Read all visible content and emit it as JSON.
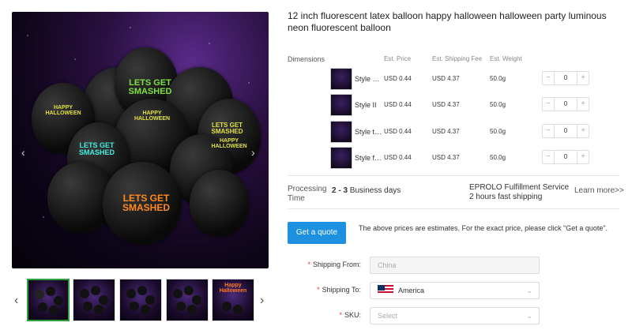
{
  "product": {
    "title": "12 inch fluorescent latex balloon happy halloween halloween party luminous neon fluorescent balloon",
    "main_image_alt": "",
    "balloon_texts": {
      "lets_get_smashed": "LETS GET SMASHED",
      "happy_halloween": "HAPPY HALLOWEEN"
    },
    "thumb_special_text": "Happy Halloween"
  },
  "table": {
    "dimensions_label": "Dimensions",
    "headers": {
      "price": "Est. Price",
      "shipping": "Est. Shipping Fee",
      "weight": "Est. Weight"
    },
    "rows": [
      {
        "style": "Style …",
        "price": "USD 0.44",
        "shipping": "USD 4.37",
        "weight": "50.0g",
        "qty": "0"
      },
      {
        "style": "Style II",
        "price": "USD 0.44",
        "shipping": "USD 4.37",
        "weight": "50.0g",
        "qty": "0"
      },
      {
        "style": "Style t…",
        "price": "USD 0.44",
        "shipping": "USD 4.37",
        "weight": "50.0g",
        "qty": "0"
      },
      {
        "style": "Style f…",
        "price": "USD 0.44",
        "shipping": "USD 4.37",
        "weight": "50.0g",
        "qty": "0"
      }
    ],
    "minus": "−",
    "plus": "+"
  },
  "processing": {
    "label_line1": "Processing",
    "label_line2": "Time",
    "days_bold": "2 - 3",
    "days_rest": " Business days",
    "service_line1": "EPROLO Fulfillment Service",
    "service_line2": "2 hours fast shipping",
    "learn_more": "Learn more>>"
  },
  "quote": {
    "button": "Get a quote",
    "note": "The above prices are estimates. For the exact price, please click \"Get a quote\"."
  },
  "form": {
    "required_mark": "*",
    "shipping_from_label": "Shipping From:",
    "shipping_from_value": "China",
    "shipping_to_label": "Shipping To:",
    "shipping_to_value": "America",
    "sku_label": "SKU:",
    "sku_placeholder": "Select"
  },
  "nav": {
    "prev": "‹",
    "next": "›",
    "thumb_prev": "‹",
    "thumb_next": "›",
    "chevron": "⌄"
  },
  "colors": {
    "accent": "#1e90e0",
    "selected_thumb": "#2e9e3e",
    "required": "#e33333"
  }
}
